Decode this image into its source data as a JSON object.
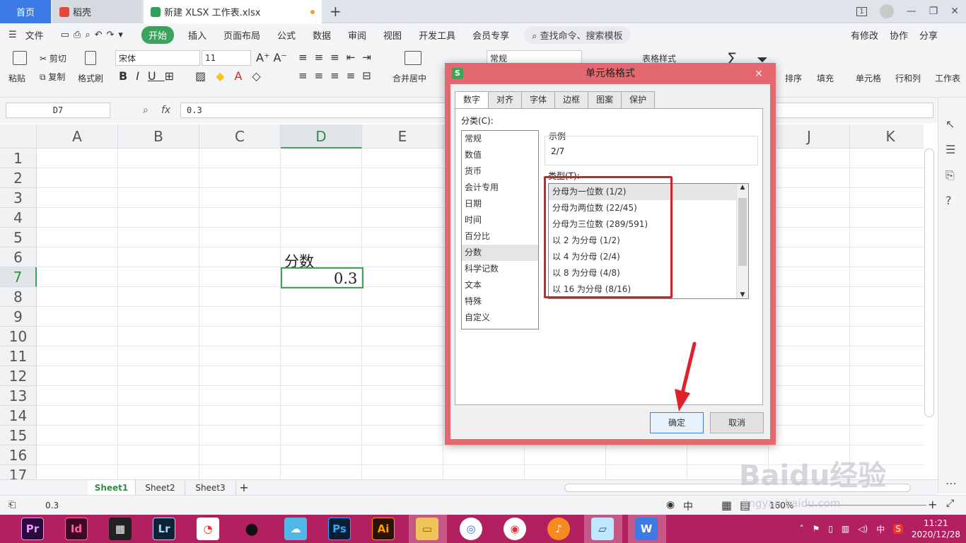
{
  "tabs": {
    "home": "首页",
    "shell": "稻壳",
    "doc": "新建 XLSX 工作表.xlsx",
    "add": "+"
  },
  "menu": {
    "file": "文件",
    "items": [
      "开始",
      "插入",
      "页面布局",
      "公式",
      "数据",
      "审阅",
      "视图",
      "开发工具",
      "会员专享"
    ],
    "search": "查找命令、搜索模板",
    "right": [
      "有修改",
      "协作",
      "分享"
    ]
  },
  "ribbon": {
    "paste": "粘贴",
    "cut": "剪切",
    "copy": "复制",
    "format_painter": "格式刷",
    "font_name": "宋体",
    "font_size": "11",
    "merge_center": "合并居中",
    "number_format": "常规",
    "table_style": "表格样式",
    "sort": "排序",
    "fill": "填充",
    "cell": "单元格",
    "row_col": "行和列",
    "worksheet": "工作表"
  },
  "formula_bar": {
    "name_box": "D7",
    "fx": "fx",
    "value": "0.3"
  },
  "columns": [
    "A",
    "B",
    "C",
    "D",
    "E",
    "F",
    "G",
    "H",
    "I",
    "J",
    "K"
  ],
  "rows": [
    "1",
    "2",
    "3",
    "4",
    "5",
    "6",
    "7",
    "8",
    "9",
    "10",
    "11",
    "12",
    "13",
    "14",
    "15",
    "16",
    "17"
  ],
  "cells": {
    "d6": "分数",
    "d7": "0.3"
  },
  "sheets": [
    "Sheet1",
    "Sheet2",
    "Sheet3"
  ],
  "status": {
    "value": "0.3",
    "zoom": "160%"
  },
  "dialog": {
    "title": "单元格格式",
    "close": "×",
    "tabs": [
      "数字",
      "对齐",
      "字体",
      "边框",
      "图案",
      "保护"
    ],
    "category_label": "分类(C):",
    "categories": [
      "常规",
      "数值",
      "货币",
      "会计专用",
      "日期",
      "时间",
      "百分比",
      "分数",
      "科学记数",
      "文本",
      "特殊",
      "自定义"
    ],
    "sample_label": "示例",
    "sample_value": "2/7",
    "type_label": "类型(T):",
    "types": [
      "分母为一位数 (1/2)",
      "分母为两位数 (22/45)",
      "分母为三位数 (289/591)",
      "以 2 为分母 (1/2)",
      "以 4 为分母 (2/4)",
      "以 8 为分母 (4/8)",
      "以 16 为分母 (8/16)"
    ],
    "ok": "确定",
    "cancel": "取消"
  },
  "taskbar": {
    "apps": [
      "Pr",
      "Id",
      "Lr",
      "Ps",
      "Ai"
    ],
    "time": "11:21",
    "date": "2020/12/28",
    "ime": "中"
  },
  "watermark": {
    "brand": "Baidu经验",
    "url": "jingyan.baidu.com"
  }
}
